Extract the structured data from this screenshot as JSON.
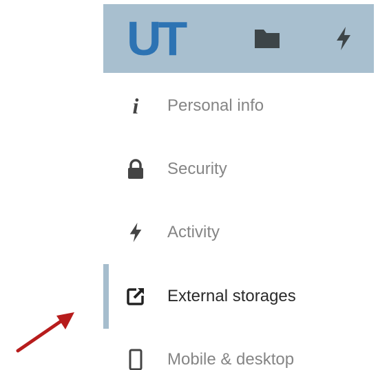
{
  "header": {
    "logo_text": "UT",
    "icons": [
      "files-folder-icon",
      "activity-lightning-icon"
    ],
    "background_color": "#a8bfcf",
    "logo_color": "#2d73b3"
  },
  "settings_nav": {
    "items": [
      {
        "label": "Personal info",
        "icon": "info-icon",
        "active": false
      },
      {
        "label": "Security",
        "icon": "lock-icon",
        "active": false
      },
      {
        "label": "Activity",
        "icon": "lightning-icon",
        "active": false
      },
      {
        "label": "External storages",
        "icon": "external-link-icon",
        "active": true
      },
      {
        "label": "Mobile & desktop",
        "icon": "phone-icon",
        "active": false
      }
    ],
    "active_indicator_color": "#a6bdcd"
  },
  "annotation": {
    "arrow_color": "#b71c1c"
  }
}
